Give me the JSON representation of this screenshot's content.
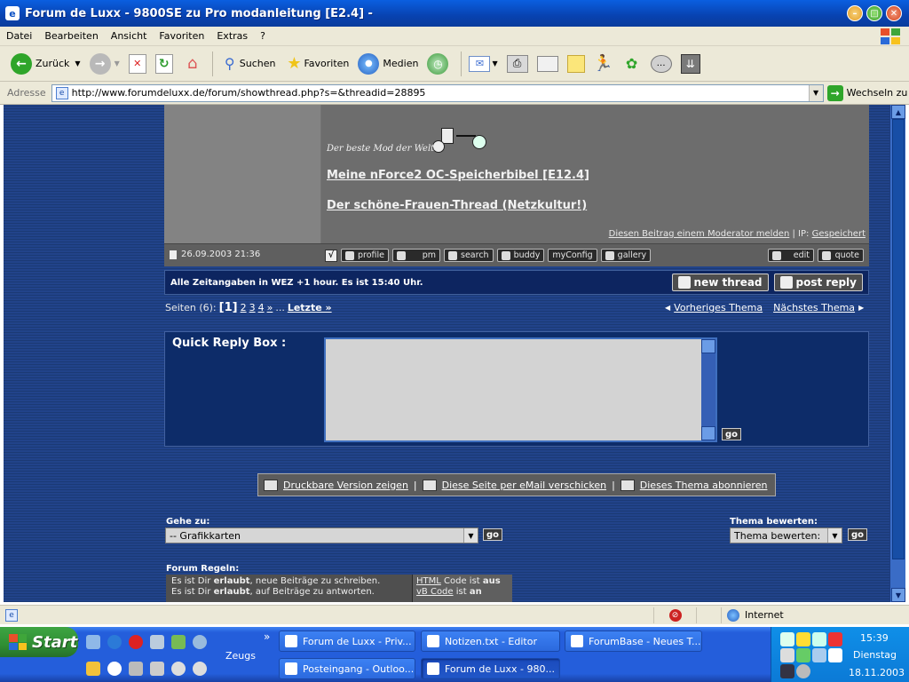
{
  "window": {
    "title": "Forum de Luxx - 9800SE zu Pro modanleitung [E2.4] -"
  },
  "menu": [
    "Datei",
    "Bearbeiten",
    "Ansicht",
    "Favoriten",
    "Extras",
    "?"
  ],
  "toolbar": {
    "back": "Zurück",
    "search": "Suchen",
    "favorites": "Favoriten",
    "media": "Medien"
  },
  "address": {
    "label": "Adresse",
    "url": "http://www.forumdeluxx.de/forum/showthread.php?s=&threadid=28895",
    "go": "Wechseln zu"
  },
  "post": {
    "sig_small": "Der beste Mod der Welt",
    "link1": "Meine nForce2 OC-Speicherbibel [E12.4]",
    "link2": "Der schöne-Frauen-Thread (Netzkultur!)",
    "report": "Diesen Beitrag einem Moderator melden",
    "ip_label": "| IP:",
    "ip_value": "Gespeichert",
    "date": "26.09.2003 21:36",
    "buttons": [
      "profile",
      "pm",
      "search",
      "buddy",
      "myConfig",
      "gallery"
    ],
    "edit": "edit",
    "quote": "quote"
  },
  "infobar": {
    "time": "Alle Zeitangaben in WEZ +1 hour. Es ist 15:40 Uhr.",
    "new_thread": "new thread",
    "post_reply": "post reply"
  },
  "pagination": {
    "label": "Seiten (6):",
    "current": "[1]",
    "pages": [
      "2",
      "3",
      "4"
    ],
    "next": "»",
    "ellipsis": "...",
    "last": "Letzte »"
  },
  "threadnav": {
    "prev": "Vorheriges Thema",
    "next": "Nächstes Thema"
  },
  "quickreply": {
    "label": "Quick Reply Box :",
    "go": "go"
  },
  "bottomlinks": [
    "Druckbare Version zeigen",
    "Diese Seite per eMail verschicken",
    "Dieses Thema abonnieren"
  ],
  "goto": {
    "label": "Gehe zu:",
    "value": "-- Grafikkarten",
    "go": "go"
  },
  "rate": {
    "label": "Thema bewerten:",
    "value": "Thema bewerten:",
    "go": "go"
  },
  "rules": {
    "label": "Forum Regeln:",
    "l1a": "Es ist Dir ",
    "l1b": "erlaubt",
    "l1c": ", neue Beiträge zu schreiben.",
    "l2a": "Es ist Dir ",
    "l2b": "erlaubt",
    "l2c": ", auf Beiträge zu antworten.",
    "r1a": "HTML",
    "r1b": " Code ist ",
    "r1c": "aus",
    "r2a": "vB Code",
    "r2b": " ist ",
    "r2c": "an"
  },
  "statusbar": {
    "zone": "Internet"
  },
  "taskbar": {
    "start": "Start",
    "toolbar_label": "Zeugs",
    "chevron": "»",
    "tasks": [
      "Forum de Luxx - Priv...",
      "Notizen.txt - Editor",
      "ForumBase - Neues T...",
      "Posteingang - Outloo...",
      "Forum de Luxx - 980..."
    ],
    "time": "15:39",
    "day": "Dienstag",
    "date": "18.11.2003"
  },
  "colors": {
    "page_bg": "#1e3f7c",
    "post_bg": "#6d6d6d",
    "accent": "#0d2560"
  }
}
